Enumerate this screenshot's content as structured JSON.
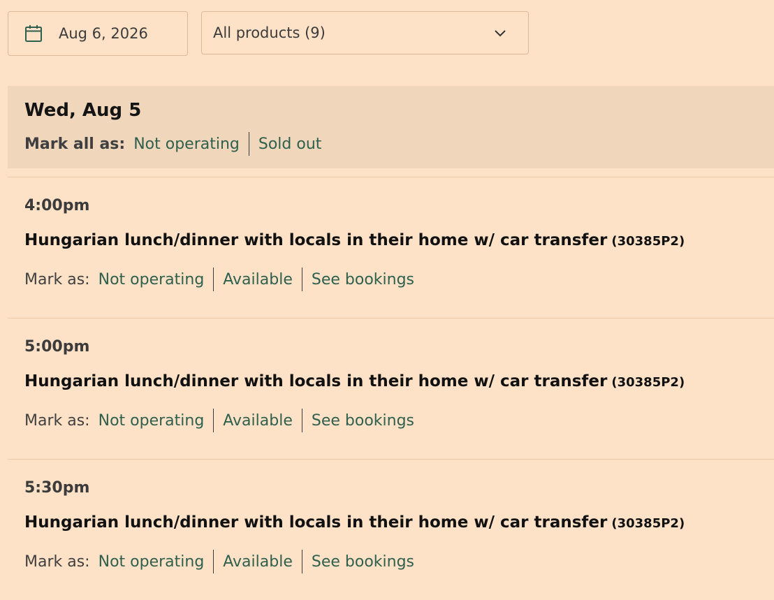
{
  "filters": {
    "date_value": "Aug 6, 2026",
    "product_select_value": "All products (9)"
  },
  "day": {
    "title": "Wed, Aug 5",
    "mark_all_label": "Mark all as:",
    "mark_all_options": [
      "Not operating",
      "Sold out"
    ]
  },
  "slots": [
    {
      "time": "4:00pm",
      "product_title": "Hungarian lunch/dinner with locals in their home w/ car transfer",
      "product_code": "(30385P2)",
      "mark_as_label": "Mark as:",
      "actions": [
        "Not operating",
        "Available",
        "See bookings"
      ]
    },
    {
      "time": "5:00pm",
      "product_title": "Hungarian lunch/dinner with locals in their home w/ car transfer",
      "product_code": "(30385P2)",
      "mark_as_label": "Mark as:",
      "actions": [
        "Not operating",
        "Available",
        "See bookings"
      ]
    },
    {
      "time": "5:30pm",
      "product_title": "Hungarian lunch/dinner with locals in their home w/ car transfer",
      "product_code": "(30385P2)",
      "mark_as_label": "Mark as:",
      "actions": [
        "Not operating",
        "Available",
        "See bookings"
      ]
    }
  ],
  "icons": {
    "date": "calendar-icon",
    "select": "chevron-down-icon"
  },
  "colors": {
    "background": "#fde2c7",
    "header_band": "#f0d6bb",
    "link": "#2f5f4d"
  }
}
